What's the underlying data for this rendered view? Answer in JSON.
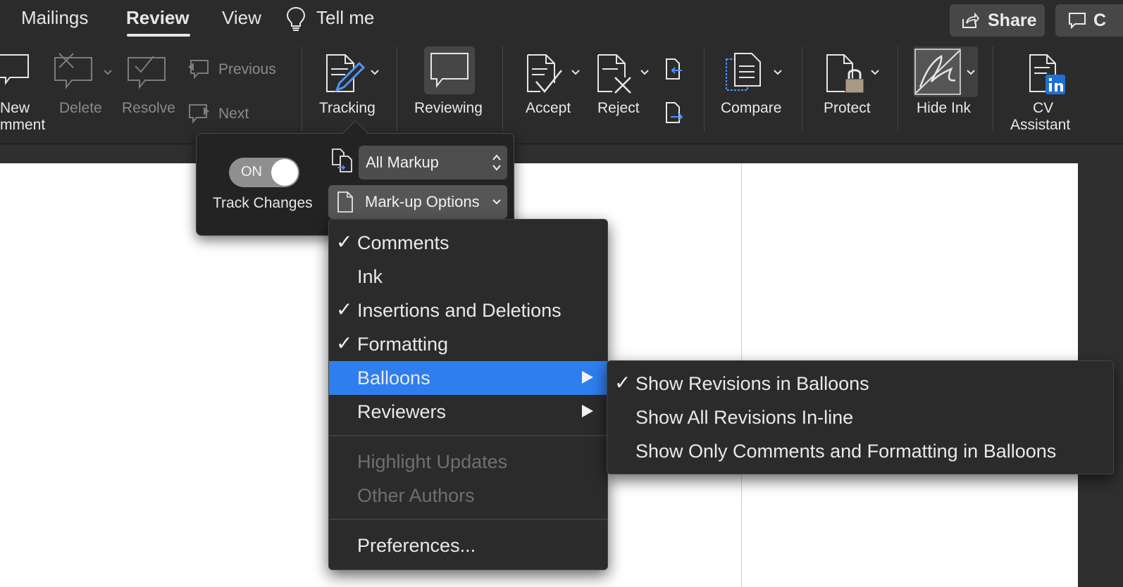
{
  "tabs": [
    {
      "label": "Mailings"
    },
    {
      "label": "Review",
      "active": true
    },
    {
      "label": "View"
    },
    {
      "label": "Tell me"
    }
  ],
  "top_buttons": {
    "share": "Share",
    "comments_partial": "C"
  },
  "ribbon": {
    "new_comment": [
      "New",
      "mment"
    ],
    "delete": "Delete",
    "resolve": "Resolve",
    "previous": "Previous",
    "next": "Next",
    "tracking": "Tracking",
    "reviewing": "Reviewing",
    "accept": "Accept",
    "reject": "Reject",
    "compare": "Compare",
    "protect": "Protect",
    "hide_ink": "Hide Ink",
    "cv_assistant": [
      "CV",
      "Assistant"
    ]
  },
  "popover": {
    "toggle_text": "ON",
    "toggle_on": true,
    "track_changes_label": "Track Changes",
    "markup_select": "All Markup",
    "markup_options": "Mark-up Options"
  },
  "markup_menu": [
    {
      "label": "Comments",
      "checked": true
    },
    {
      "label": "Ink",
      "checked": false
    },
    {
      "label": "Insertions and Deletions",
      "checked": true
    },
    {
      "label": "Formatting",
      "checked": true
    },
    {
      "label": "Balloons",
      "submenu": true,
      "highlighted": true
    },
    {
      "label": "Reviewers",
      "submenu": true
    },
    {
      "label": "Highlight Updates",
      "disabled": true
    },
    {
      "label": "Other Authors",
      "disabled": true
    },
    {
      "label": "Preferences..."
    }
  ],
  "balloons_submenu": [
    {
      "label": "Show Revisions in Balloons",
      "checked": true
    },
    {
      "label": "Show All Revisions In-line",
      "checked": false
    },
    {
      "label": "Show Only Comments and Formatting in Balloons",
      "checked": false
    }
  ],
  "colors": {
    "accent": "#2f7ef0",
    "ribbon_bg": "#2b2b2b",
    "menu_bg": "#2b2b2b",
    "linkedin_blue": "#1f6fd6"
  },
  "checkmark_glyph": "✓"
}
